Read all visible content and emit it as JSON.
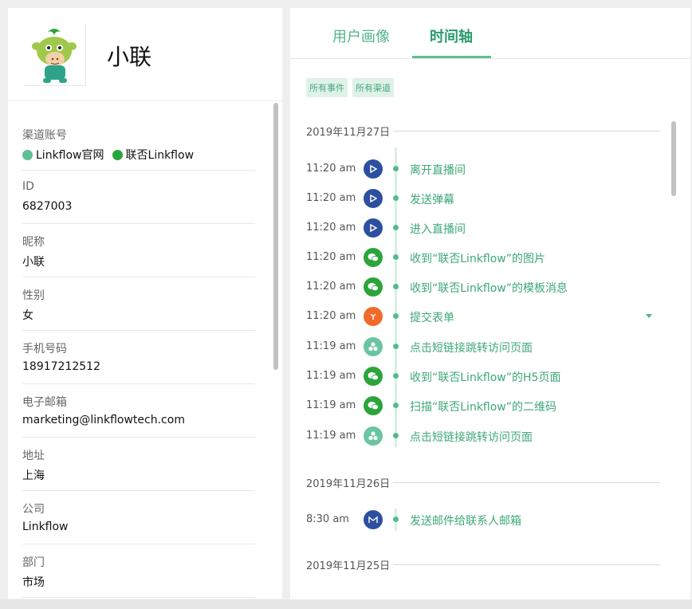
{
  "profile": {
    "name": "小联",
    "avatar_icon": "mascot-avatar"
  },
  "fields": [
    {
      "label": "渠道账号",
      "channels": [
        {
          "icon": "linkflow-icon",
          "color": "#5cbf93",
          "name": "Linkflow官网"
        },
        {
          "icon": "wechat-icon",
          "color": "#2ca43c",
          "name": "联否Linkflow"
        }
      ]
    },
    {
      "label": "ID",
      "value": "6827003"
    },
    {
      "label": "昵称",
      "value": "小联"
    },
    {
      "label": "性别",
      "value": "女"
    },
    {
      "label": "手机号码",
      "value": "18917212512"
    },
    {
      "label": "电子邮箱",
      "value": "marketing@linkflowtech.com"
    },
    {
      "label": "地址",
      "value": "上海"
    },
    {
      "label": "公司",
      "value": "Linkflow"
    },
    {
      "label": "部门",
      "value": "市场"
    }
  ],
  "tabs": [
    {
      "label": "用户画像",
      "active": false
    },
    {
      "label": "时间轴",
      "active": true
    }
  ],
  "filters": [
    "所有事件",
    "所有渠道"
  ],
  "timeline": [
    {
      "date": "2019年11月27日",
      "events": [
        {
          "time": "11:20 am",
          "icon": "live-play-icon",
          "text": "离开直播间"
        },
        {
          "time": "11:20 am",
          "icon": "live-play-icon",
          "text": "发送弹幕"
        },
        {
          "time": "11:20 am",
          "icon": "live-play-icon",
          "text": "进入直播间"
        },
        {
          "time": "11:20 am",
          "icon": "wechat-icon",
          "text": "收到“联否Linkflow”的图片"
        },
        {
          "time": "11:20 am",
          "icon": "wechat-icon",
          "text": "收到“联否Linkflow”的模板消息"
        },
        {
          "time": "11:20 am",
          "icon": "form-icon",
          "text": "提交表单",
          "expandable": true
        },
        {
          "time": "11:19 am",
          "icon": "short-link-icon",
          "text": "点击短链接跳转访问页面"
        },
        {
          "time": "11:19 am",
          "icon": "wechat-icon",
          "text": "收到“联否Linkflow”的H5页面"
        },
        {
          "time": "11:19 am",
          "icon": "wechat-icon",
          "text": "扫描“联否Linkflow”的二维码"
        },
        {
          "time": "11:19 am",
          "icon": "short-link-icon",
          "text": "点击短链接跳转访问页面"
        }
      ]
    },
    {
      "date": "2019年11月26日",
      "events": [
        {
          "time": "8:30 am",
          "icon": "mail-icon",
          "text": "发送邮件给联系人邮箱"
        }
      ]
    },
    {
      "date": "2019年11月25日",
      "events": []
    }
  ],
  "colors": {
    "accent": "#52b38a",
    "live": "#2d4fa0",
    "wechat": "#2ca43c",
    "form": "#f06a2a"
  }
}
